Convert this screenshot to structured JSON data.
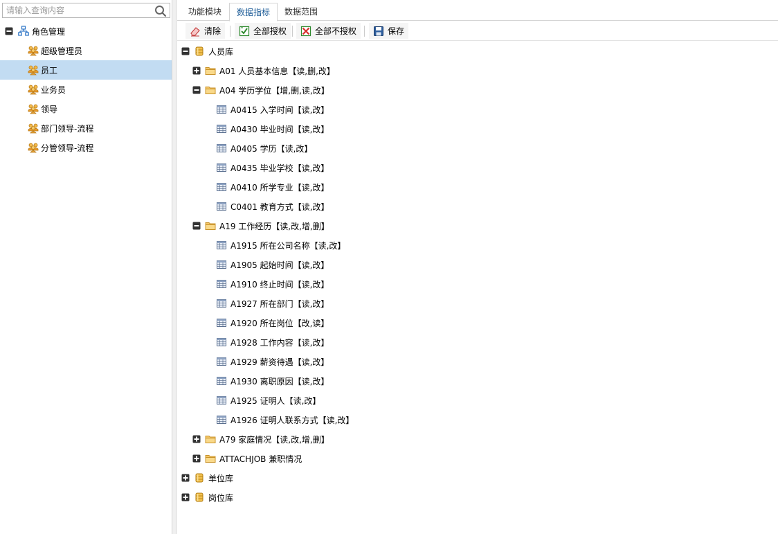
{
  "search": {
    "placeholder": "请输入查询内容"
  },
  "left_tree": {
    "root": {
      "label": "角色管理",
      "expanded": true
    },
    "items": [
      {
        "label": "超级管理员",
        "selected": false
      },
      {
        "label": "员工",
        "selected": true
      },
      {
        "label": "业务员",
        "selected": false
      },
      {
        "label": "领导",
        "selected": false
      },
      {
        "label": "部门领导-流程",
        "selected": false
      },
      {
        "label": "分管领导-流程",
        "selected": false
      }
    ]
  },
  "tabs": [
    {
      "label": "功能模块",
      "active": false
    },
    {
      "label": "数据指标",
      "active": true
    },
    {
      "label": "数据范围",
      "active": false
    }
  ],
  "toolbar": {
    "clear": "清除",
    "grant_all": "全部授权",
    "revoke_all": "全部不授权",
    "save": "保存"
  },
  "data_tree": [
    {
      "label": "人员库",
      "type": "db",
      "level": 0,
      "expander": "minus"
    },
    {
      "label": "A01 人员基本信息【读,删,改】",
      "type": "folder",
      "level": 1,
      "expander": "plus"
    },
    {
      "label": "A04 学历学位【增,删,读,改】",
      "type": "folder",
      "level": 1,
      "expander": "minus"
    },
    {
      "label": "A0415 入学时间【读,改】",
      "type": "field",
      "level": 2,
      "expander": ""
    },
    {
      "label": "A0430 毕业时间【读,改】",
      "type": "field",
      "level": 2,
      "expander": ""
    },
    {
      "label": "A0405 学历【读,改】",
      "type": "field",
      "level": 2,
      "expander": ""
    },
    {
      "label": "A0435 毕业学校【读,改】",
      "type": "field",
      "level": 2,
      "expander": ""
    },
    {
      "label": "A0410 所学专业【读,改】",
      "type": "field",
      "level": 2,
      "expander": ""
    },
    {
      "label": "C0401 教育方式【读,改】",
      "type": "field",
      "level": 2,
      "expander": ""
    },
    {
      "label": "A19 工作经历【读,改,增,删】",
      "type": "folder",
      "level": 1,
      "expander": "minus"
    },
    {
      "label": "A1915 所在公司名称【读,改】",
      "type": "field",
      "level": 2,
      "expander": ""
    },
    {
      "label": "A1905 起始时间【读,改】",
      "type": "field",
      "level": 2,
      "expander": ""
    },
    {
      "label": "A1910 终止时间【读,改】",
      "type": "field",
      "level": 2,
      "expander": ""
    },
    {
      "label": "A1927 所在部门【读,改】",
      "type": "field",
      "level": 2,
      "expander": ""
    },
    {
      "label": "A1920 所在岗位【改,读】",
      "type": "field",
      "level": 2,
      "expander": ""
    },
    {
      "label": "A1928 工作内容【读,改】",
      "type": "field",
      "level": 2,
      "expander": ""
    },
    {
      "label": "A1929 薪资待遇【读,改】",
      "type": "field",
      "level": 2,
      "expander": ""
    },
    {
      "label": "A1930 离职原因【读,改】",
      "type": "field",
      "level": 2,
      "expander": ""
    },
    {
      "label": "A1925 证明人【读,改】",
      "type": "field",
      "level": 2,
      "expander": ""
    },
    {
      "label": "A1926 证明人联系方式【读,改】",
      "type": "field",
      "level": 2,
      "expander": ""
    },
    {
      "label": "A79 家庭情况【读,改,增,删】",
      "type": "folder",
      "level": 1,
      "expander": "plus"
    },
    {
      "label": "ATTACHJOB 兼职情况",
      "type": "folder",
      "level": 1,
      "expander": "plus"
    },
    {
      "label": "单位库",
      "type": "db",
      "level": 0,
      "expander": "plus"
    },
    {
      "label": "岗位库",
      "type": "db",
      "level": 0,
      "expander": "plus"
    }
  ],
  "colors": {
    "selected_bg": "#c2dcf2",
    "active_tab_text": "#1a5a96",
    "folder": "#f3c35b",
    "db": "#e8b23c"
  }
}
